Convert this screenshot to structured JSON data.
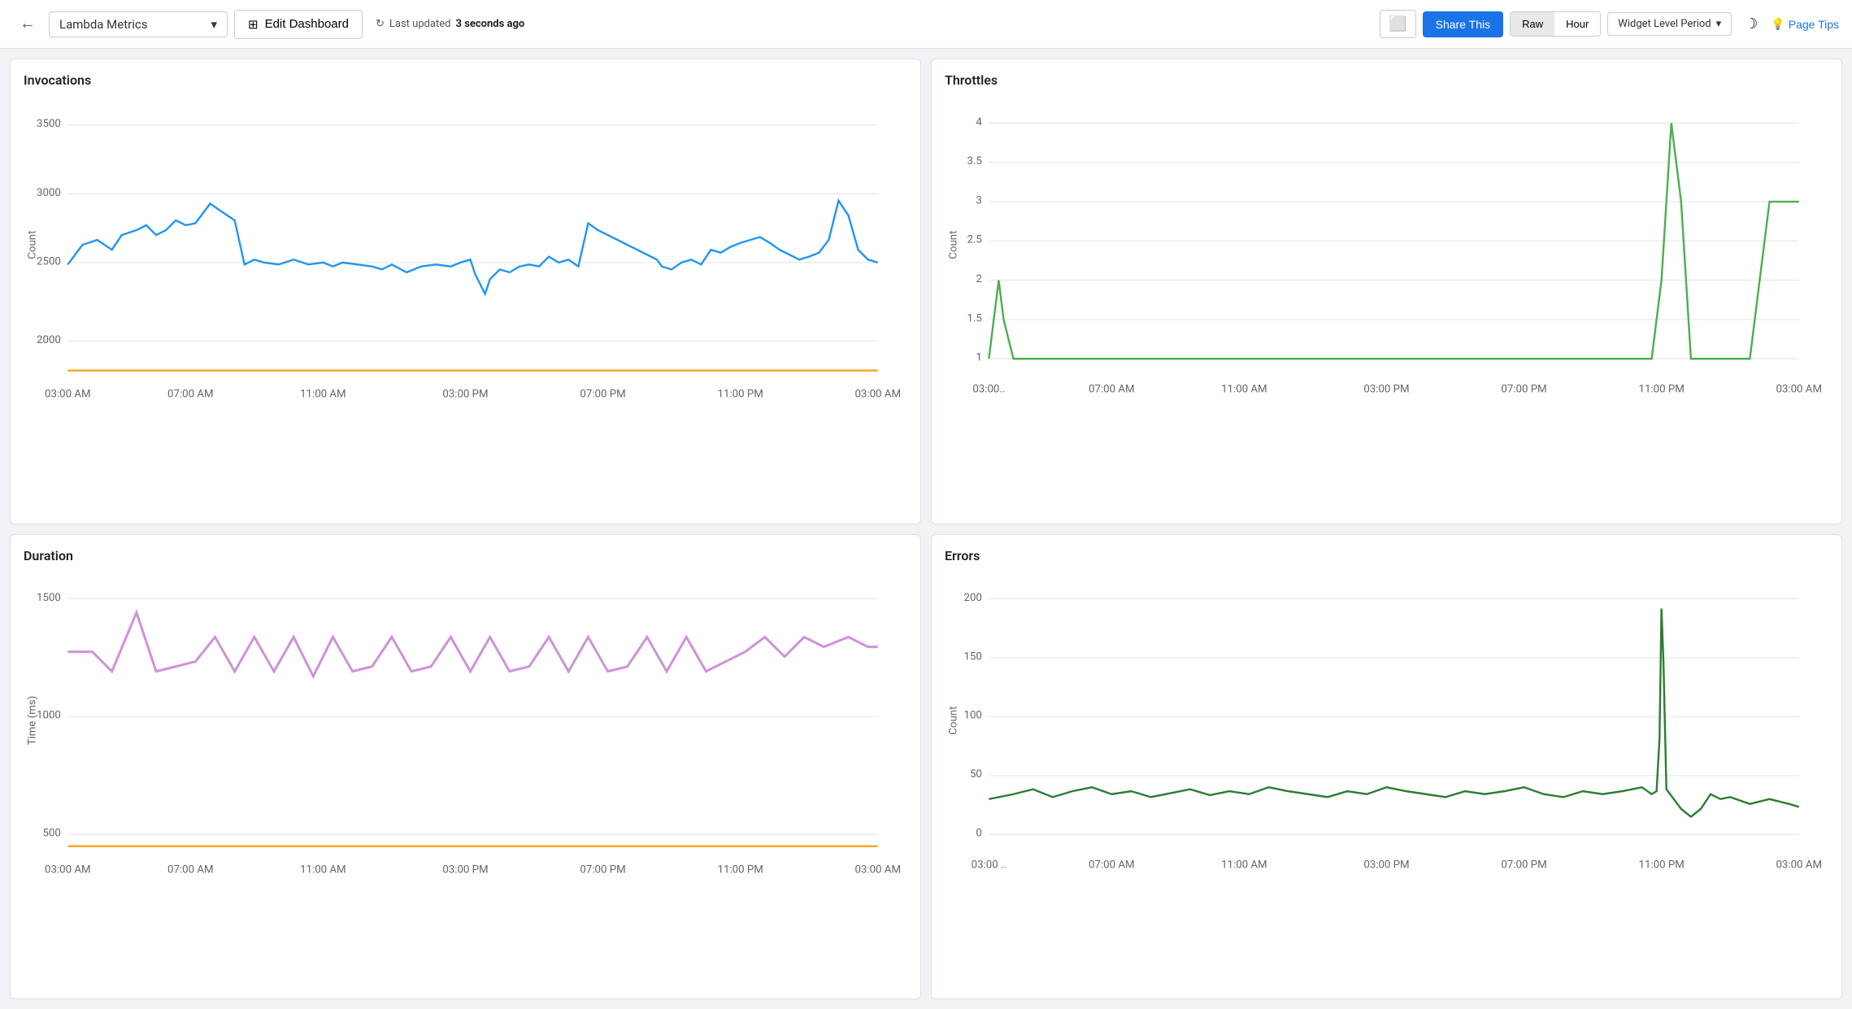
{
  "header": {
    "back_label": "←",
    "dashboard_name": "Lambda Metrics",
    "dashboard_dropdown_icon": "▾",
    "edit_icon": "⊞",
    "edit_label": "Edit Dashboard",
    "refresh_icon": "↻",
    "last_updated": "Last updated",
    "last_updated_time": "3 seconds ago",
    "monitor_icon": "⬜",
    "share_label": "Share This",
    "raw_label": "Raw",
    "hour_label": "Hour",
    "widget_period_label": "Widget Level Period",
    "widget_period_icon": "▾",
    "dark_mode_icon": "☽",
    "page_tips_icon": "💡",
    "page_tips_label": "Page Tips"
  },
  "widgets": {
    "invocations": {
      "title": "Invocations",
      "y_axis_label": "Count",
      "x_labels": [
        "03:00 AM",
        "07:00 AM",
        "11:00 AM",
        "03:00 PM",
        "07:00 PM",
        "11:00 PM",
        "03:00 AM"
      ],
      "y_labels": [
        "2000",
        "2500",
        "3000",
        "3500"
      ],
      "color": "#2196F3",
      "baseline_color": "#FFA726"
    },
    "throttles": {
      "title": "Throttles",
      "y_axis_label": "Count",
      "x_labels": [
        "03:00..",
        "07:00 AM",
        "11:00 AM",
        "03:00 PM",
        "07:00 PM",
        "11:00 PM",
        "03:00 AM"
      ],
      "y_labels": [
        "1",
        "1.5",
        "2",
        "2.5",
        "3",
        "3.5",
        "4"
      ],
      "color": "#4CAF50"
    },
    "duration": {
      "title": "Duration",
      "y_axis_label": "Time (ms)",
      "x_labels": [
        "03:00 AM",
        "07:00 AM",
        "11:00 AM",
        "03:00 PM",
        "07:00 PM",
        "11:00 PM",
        "03:00 AM"
      ],
      "y_labels": [
        "500",
        "1000",
        "1500"
      ],
      "color": "#CE93D8",
      "baseline_color": "#FFA726"
    },
    "errors": {
      "title": "Errors",
      "y_axis_label": "Count",
      "x_labels": [
        "03:00 ..",
        "07:00 AM",
        "11:00 AM",
        "03:00 PM",
        "07:00 PM",
        "11:00 PM",
        "03:00 AM"
      ],
      "y_labels": [
        "0",
        "50",
        "100",
        "150",
        "200"
      ],
      "color": "#2E7D32"
    }
  }
}
